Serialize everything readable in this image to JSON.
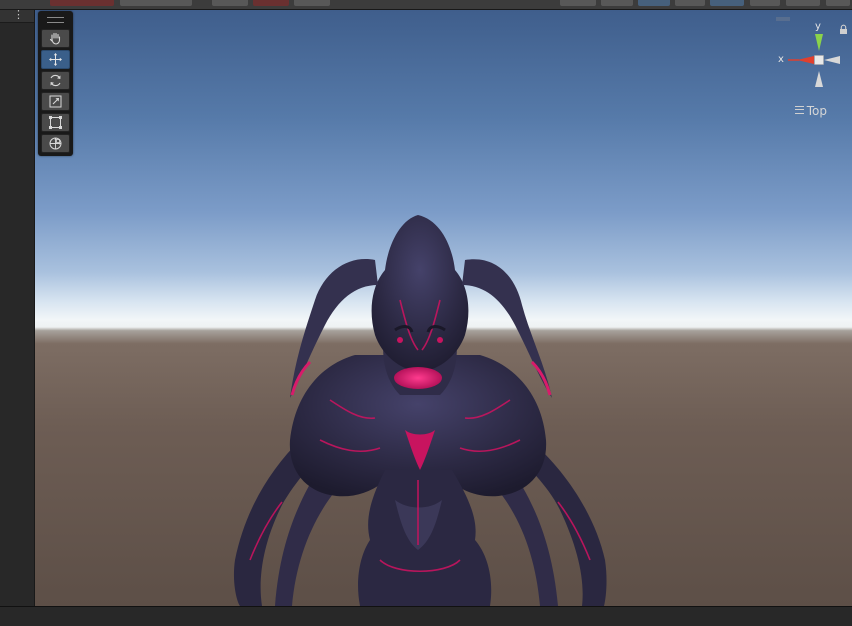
{
  "left_panel": {
    "menu_glyph": "⋮"
  },
  "tool_palette": {
    "tools": [
      {
        "name": "hand-tool",
        "icon": "hand-icon",
        "active": false
      },
      {
        "name": "move-tool",
        "icon": "move-arrows-icon",
        "active": true
      },
      {
        "name": "rotate-tool",
        "icon": "rotate-icon",
        "active": false
      },
      {
        "name": "scale-tool",
        "icon": "scale-icon",
        "active": false
      },
      {
        "name": "rect-tool",
        "icon": "rect-transform-icon",
        "active": false
      },
      {
        "name": "transform-tool",
        "icon": "transform-icon",
        "active": false
      }
    ]
  },
  "gizmo": {
    "y_label": "y",
    "x_label": "x",
    "view_mode": "Top",
    "colors": {
      "y_axis": "#8bd34a",
      "x_axis": "#e0402e",
      "neutral": "#d8d8d8"
    }
  },
  "scene": {
    "sky_top": "#3f5e8c",
    "horizon": "#f2f6f8",
    "ground": "#6d5d54",
    "creature_body": "#2b2840",
    "creature_glow": "#d81b6a"
  }
}
